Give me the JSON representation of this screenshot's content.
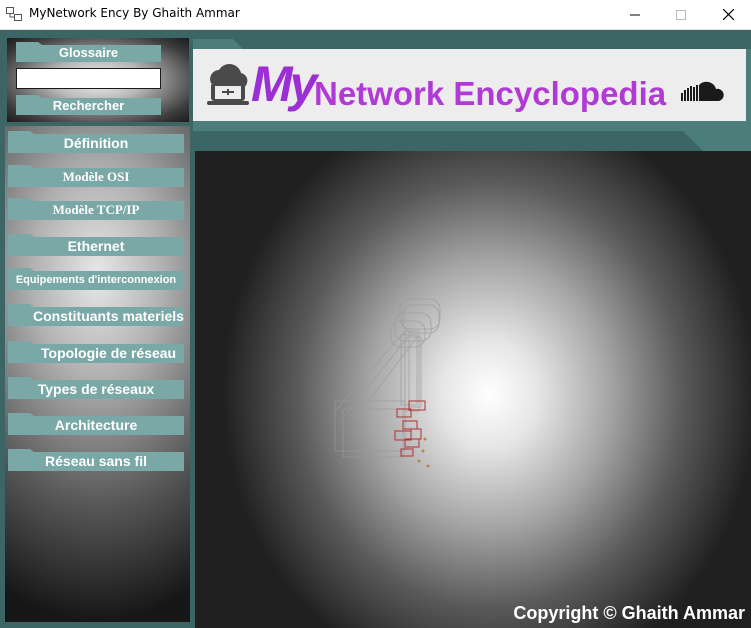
{
  "window": {
    "title": "MyNetwork Ency By Ghaith Ammar",
    "controls": [
      "minimize-icon",
      "maximize-icon",
      "close-icon"
    ]
  },
  "search": {
    "glossary_label": "Glossaire",
    "input_value": "",
    "search_label": "Rechercher"
  },
  "nav": {
    "items": [
      {
        "label": "Définition"
      },
      {
        "label": "Modèle OSI"
      },
      {
        "label": "Modèle TCP/IP"
      },
      {
        "label": "Ethernet"
      },
      {
        "label": "Equipements d'interconnexion"
      },
      {
        "label": "Constituants materiels"
      },
      {
        "label": "Topologie de réseau"
      },
      {
        "label": "Types de réseaux"
      },
      {
        "label": "Architecture"
      },
      {
        "label": "Réseau sans fil"
      }
    ]
  },
  "header": {
    "brand_my": "My",
    "brand_rest": "Network Encyclopedia",
    "icons": [
      "cloud-laptop-icon",
      "soundcloud-icon"
    ]
  },
  "footer": {
    "copyright": "Copyright © Ghaith Ammar"
  },
  "colors": {
    "frame": "#3c6565",
    "button": "#79a8a6",
    "brand": "#b13ad6",
    "illustration_accent": "#b03030"
  }
}
